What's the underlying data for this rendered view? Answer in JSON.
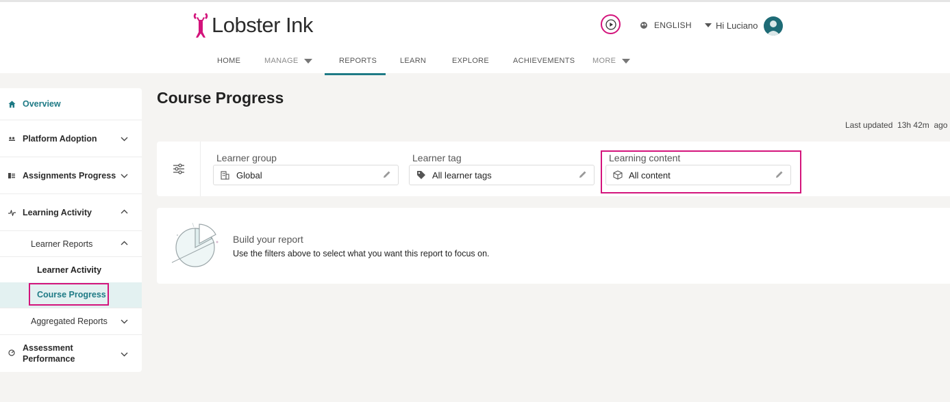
{
  "brand": {
    "name": "Lobster Ink",
    "accent": "#d3137b",
    "teal": "#1e7a85"
  },
  "header": {
    "language": "ENGLISH",
    "greeting": "Hi Luciano"
  },
  "nav": {
    "home": "HOME",
    "manage": "MANAGE",
    "reports": "REPORTS",
    "learn": "LEARN",
    "explore": "EXPLORE",
    "achievements": "ACHIEVEMENTS",
    "more": "MORE"
  },
  "sidebar": {
    "overview": "Overview",
    "platform_adoption": "Platform Adoption",
    "assignments_progress": "Assignments Progress",
    "learning_activity": "Learning Activity",
    "learner_reports": "Learner Reports",
    "learner_activity": "Learner Activity",
    "course_progress": "Course Progress",
    "aggregated_reports": "Aggregated Reports",
    "assessment_performance_1": "Assessment",
    "assessment_performance_2": "Performance"
  },
  "main": {
    "title": "Course Progress",
    "last_updated_label": "Last updated",
    "last_updated_value": "13h 42m",
    "last_updated_suffix": "ago",
    "filters": [
      {
        "label": "Learner group",
        "value": "Global",
        "icon": "building-icon"
      },
      {
        "label": "Learner tag",
        "value": "All learner tags",
        "icon": "tag-icon"
      },
      {
        "label": "Learning content",
        "value": "All content",
        "icon": "cube-icon"
      }
    ],
    "report": {
      "title": "Build your report",
      "description": "Use the filters above to select what you want this report to focus on."
    }
  }
}
